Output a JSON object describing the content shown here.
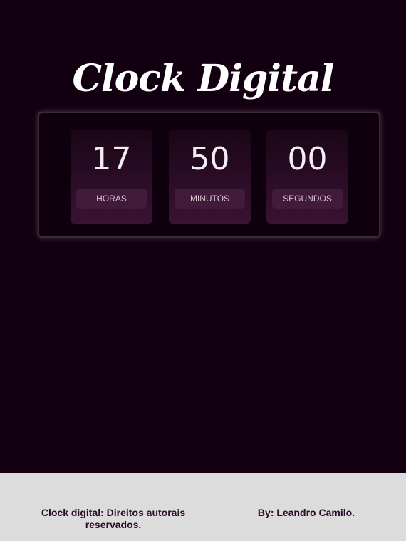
{
  "header": {
    "title": "Clock Digital"
  },
  "clock": {
    "units": [
      {
        "value": "17",
        "label": "HORAS"
      },
      {
        "value": "50",
        "label": "MINUTOS"
      },
      {
        "value": "00",
        "label": "SEGUNDOS"
      }
    ]
  },
  "footer": {
    "copyright": "Clock digital: Direitos autorais reservados.",
    "author": "By: Leandro Camilo."
  },
  "colors": {
    "background": "#120010",
    "card_accent": "#3a1233",
    "footer_background": "#dcdcdc",
    "footer_text": "#2a0a26"
  }
}
